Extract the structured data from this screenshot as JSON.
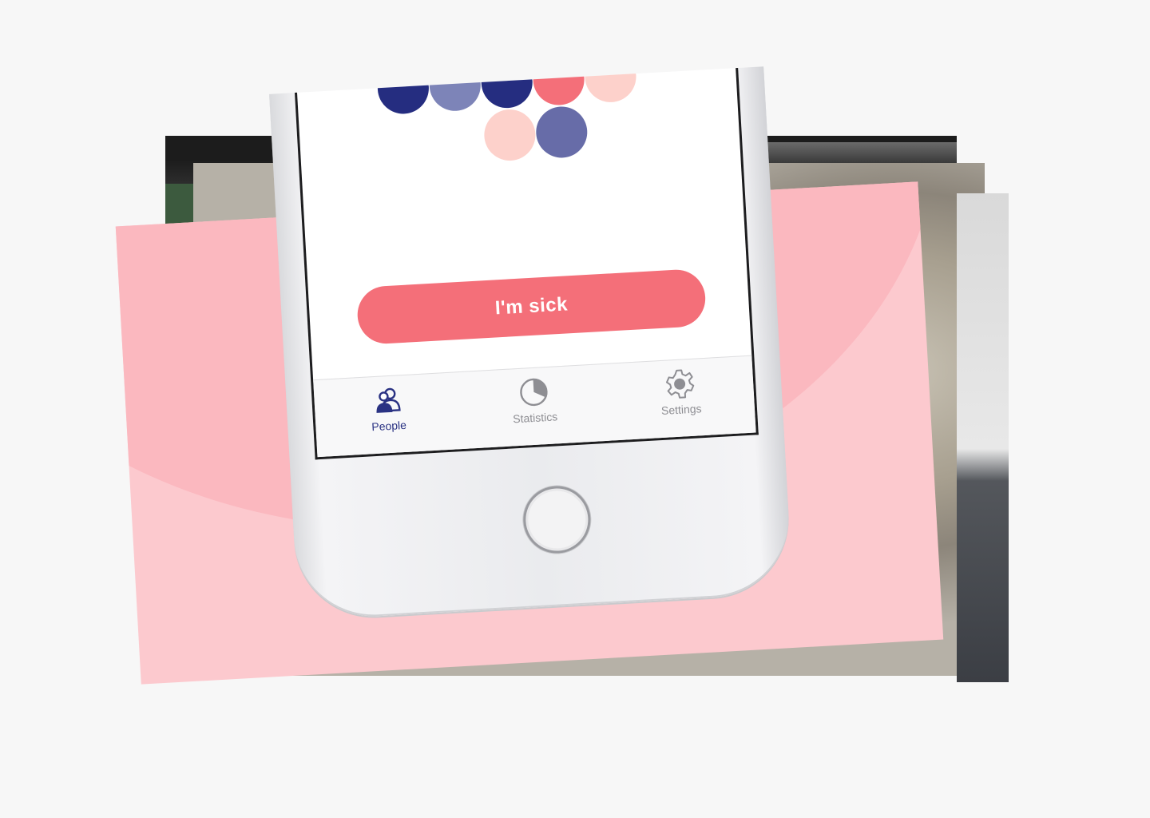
{
  "main_button": {
    "label": "I'm sick"
  },
  "tab_bar": {
    "tabs": [
      {
        "label": "People",
        "icon": "people-icon",
        "active": true
      },
      {
        "label": "Statistics",
        "icon": "pie-chart-icon",
        "active": false
      },
      {
        "label": "Settings",
        "icon": "gear-icon",
        "active": false
      }
    ]
  },
  "colors": {
    "primary_red": "#f46f79",
    "navy": "#252d80",
    "periwinkle": "#7d84b8",
    "slate_blue": "#676ca8",
    "peach": "#fdd1cb",
    "pink_background": "#fcc9ce",
    "tab_active": "#2a3283",
    "tab_inactive": "#8e8e93"
  }
}
